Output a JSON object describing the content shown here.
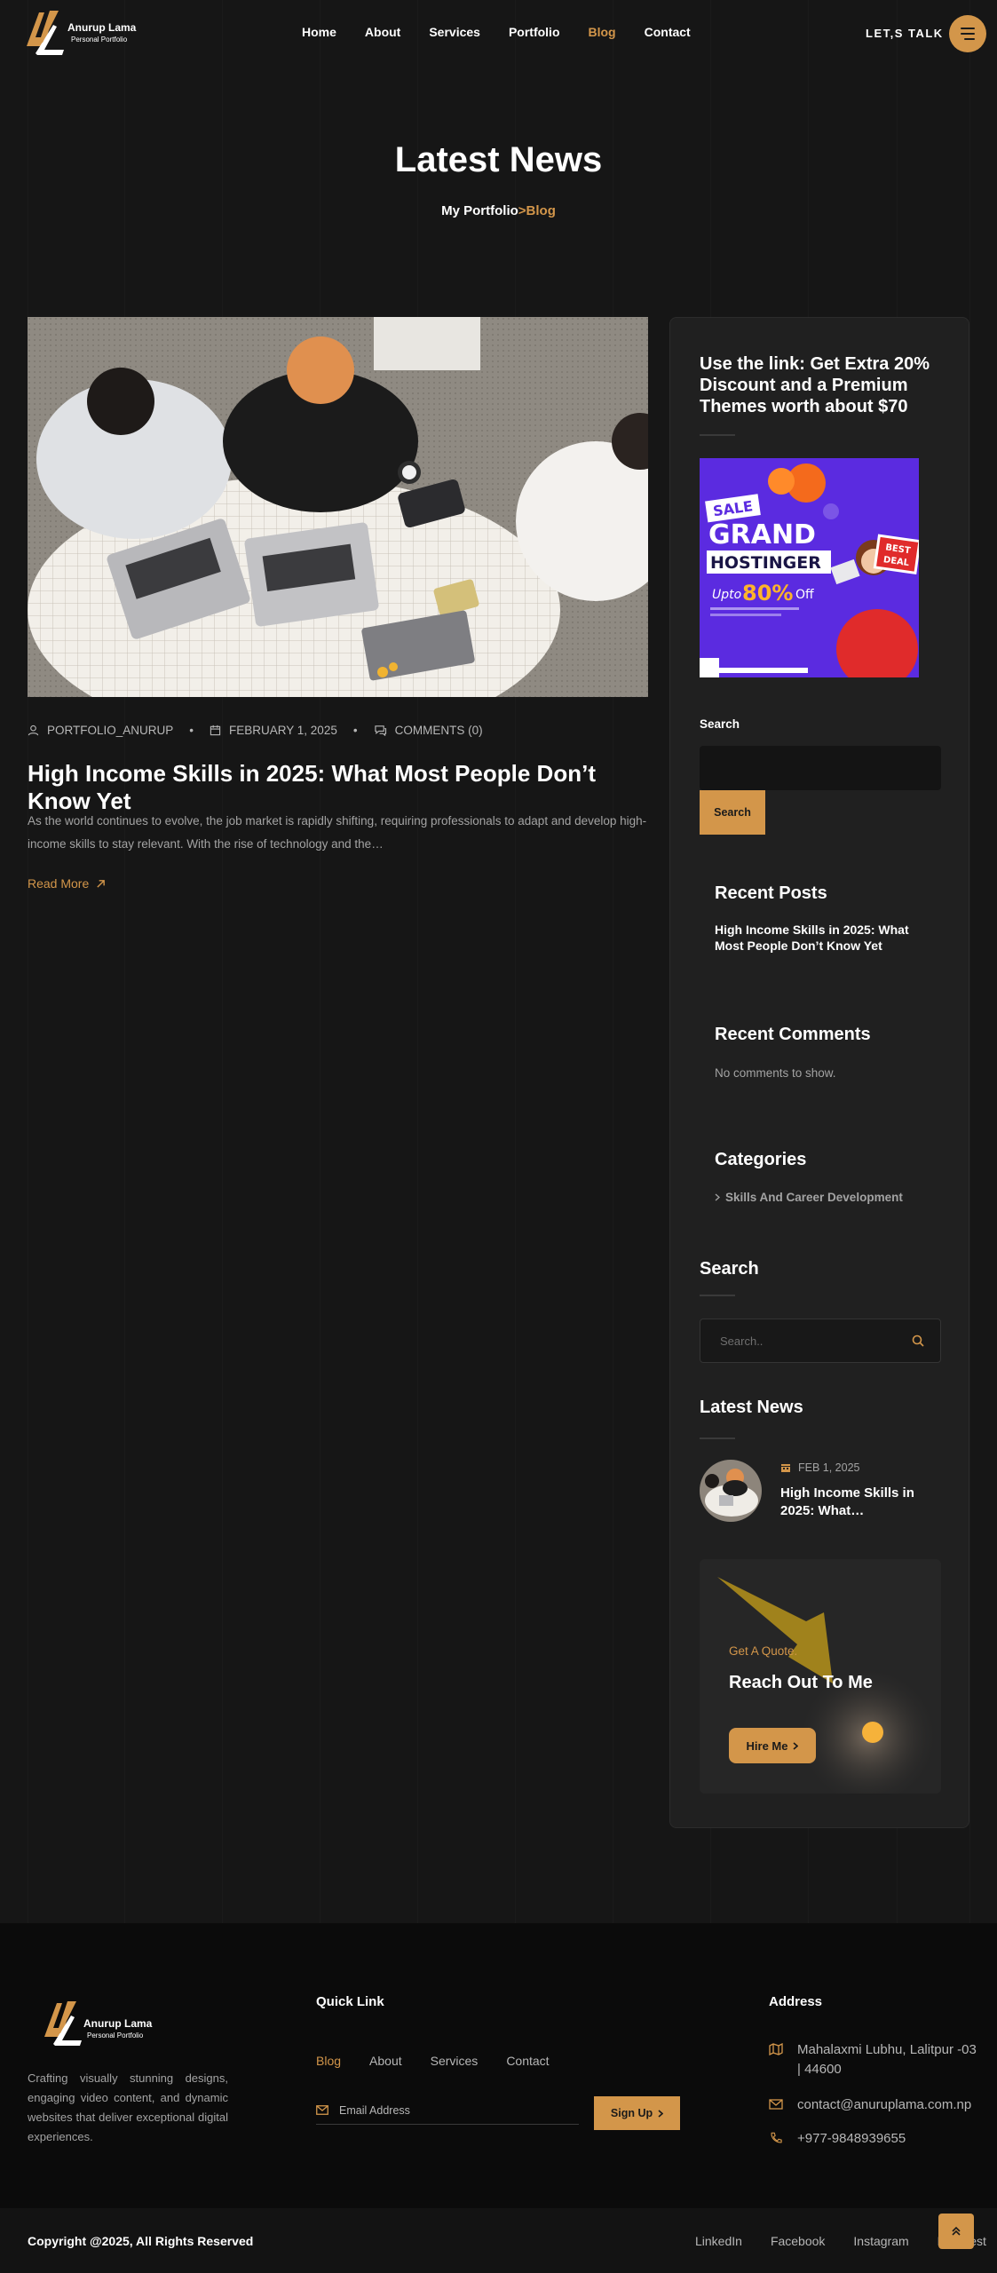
{
  "header": {
    "brand_name": "Anurup Lama",
    "brand_tagline": "Personal Portfolio",
    "nav": [
      {
        "label": "Home"
      },
      {
        "label": "About"
      },
      {
        "label": "Services"
      },
      {
        "label": "Portfolio"
      },
      {
        "label": "Blog",
        "active": true
      },
      {
        "label": "Contact"
      }
    ],
    "cta_label": "LET,S TALK",
    "menu_icon": "hamburger-icon"
  },
  "hero": {
    "title": "Latest News",
    "breadcrumb_root": "My Portfolio",
    "breadcrumb_sep": ">",
    "breadcrumb_current": "Blog"
  },
  "post": {
    "author": "PORTFOLIO_ANURUP",
    "date": "FEBRUARY 1, 2025",
    "comments": "COMMENTS (0)",
    "title": "High Income Skills in 2025: What Most People Don’t Know Yet",
    "excerpt": "As the world continues to evolve, the job market is rapidly shifting, requiring professionals to adapt and develop high-income skills to stay relevant. With the rise of technology and the…",
    "read_more": "Read More"
  },
  "sidebar": {
    "promo_title": "Use the link: Get Extra 20% Discount and a Premium Themes worth about $70",
    "banner": {
      "sale": "SALE",
      "grand": "GRAND",
      "brand": "HOSTINGER",
      "upto": "Upto",
      "percent": "80%",
      "off": "Off",
      "best_deal_1": "BEST",
      "best_deal_2": "DEAL"
    },
    "search_label": "Search",
    "search_button": "Search",
    "recent_posts_title": "Recent Posts",
    "recent_post": "High Income Skills in 2025: What Most People Don’t Know Yet",
    "recent_comments_title": "Recent Comments",
    "no_comments": "No comments to show.",
    "categories_title": "Categories",
    "category": "Skills And Career Development",
    "search2_title": "Search",
    "search2_placeholder": "Search..",
    "latest_news_title": "Latest News",
    "news_date": "FEB 1, 2025",
    "news_title": "High Income Skills in 2025: What…",
    "quote_tag": "Get A Quote.",
    "quote_title": "Reach Out To Me",
    "hire_label": "Hire Me"
  },
  "footer": {
    "brand_name": "Anurup Lama",
    "brand_tagline": "Personal Portfolio",
    "about": "Crafting visually stunning designs, engaging video content, and dynamic websites that deliver exceptional digital experiences.",
    "quick_link_title": "Quick Link",
    "links": [
      {
        "label": "Blog",
        "active": true
      },
      {
        "label": "About"
      },
      {
        "label": "Services"
      },
      {
        "label": "Contact"
      }
    ],
    "email_placeholder": "Email Address",
    "signup_label": "Sign Up",
    "address_title": "Address",
    "address": "Mahalaxmi Lubhu, Lalitpur -03 | 44600",
    "email": "contact@anuruplama.com.np",
    "phone": "+977-9848939655",
    "copyright": "Copyright @2025, All Rights Reserved",
    "social": [
      "LinkedIn",
      "Facebook",
      "Instagram",
      "Pinterest"
    ]
  },
  "colors": {
    "accent": "#d3964a",
    "background": "#161616",
    "sidebar": "#202020",
    "footer": "#0b0b0b"
  }
}
